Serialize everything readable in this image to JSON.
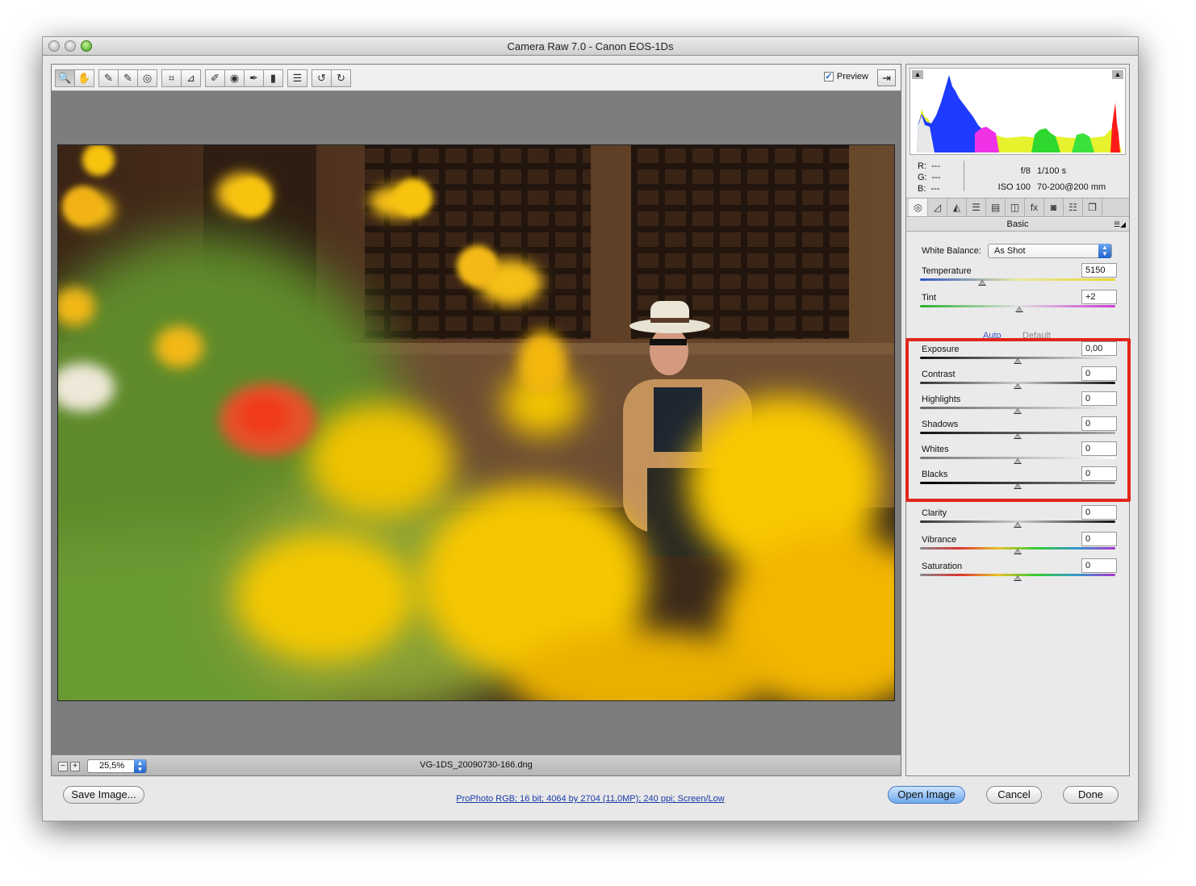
{
  "window": {
    "title": "Camera Raw 7.0  -  Canon EOS-1Ds"
  },
  "toolbar": {
    "tools": [
      {
        "name": "zoom-tool",
        "glyph": "🔍"
      },
      {
        "name": "hand-tool",
        "glyph": "✋"
      },
      {
        "name": "white-balance-tool",
        "glyph": "✎"
      },
      {
        "name": "color-sampler-tool",
        "glyph": "✎"
      },
      {
        "name": "targeted-adjustment-tool",
        "glyph": "◎"
      },
      {
        "name": "crop-tool",
        "glyph": "⌗"
      },
      {
        "name": "straighten-tool",
        "glyph": "⊿"
      },
      {
        "name": "spot-removal-tool",
        "glyph": "✐"
      },
      {
        "name": "red-eye-removal-tool",
        "glyph": "◉"
      },
      {
        "name": "adjustment-brush-tool",
        "glyph": "✒"
      },
      {
        "name": "graduated-filter-tool",
        "glyph": "▮"
      },
      {
        "name": "preferences-tool",
        "glyph": "☰"
      },
      {
        "name": "rotate-left-tool",
        "glyph": "↺"
      },
      {
        "name": "rotate-right-tool",
        "glyph": "↻"
      }
    ],
    "preview_label": "Preview",
    "preview_checked": "✓"
  },
  "status": {
    "zoom": "25,5%",
    "filename": "VG-1DS_20090730-166.dng",
    "minus": "−",
    "plus": "+"
  },
  "info": {
    "r_label": "R:",
    "r_value": "---",
    "g_label": "G:",
    "g_value": "---",
    "b_label": "B:",
    "b_value": "---",
    "aperture": "f/8",
    "shutter": "1/100 s",
    "iso": "ISO 100",
    "lens": "70-200@200 mm"
  },
  "tabs": [
    "◎",
    "◿",
    "◭",
    "☰",
    "▤",
    "◫",
    "fx",
    "◙",
    "☷",
    "❐"
  ],
  "panel": {
    "title": "Basic",
    "white_balance_label": "White Balance:",
    "white_balance_value": "As Shot",
    "auto_label": "Auto",
    "default_label": "Default",
    "sliders": {
      "temperature": {
        "label": "Temperature",
        "value": "5150",
        "level": 0.32
      },
      "tint": {
        "label": "Tint",
        "value": "+2",
        "level": 0.51
      },
      "exposure": {
        "label": "Exposure",
        "value": "0,00",
        "level": 0.5
      },
      "contrast": {
        "label": "Contrast",
        "value": "0",
        "level": 0.5
      },
      "highlights": {
        "label": "Highlights",
        "value": "0",
        "level": 0.5
      },
      "shadows": {
        "label": "Shadows",
        "value": "0",
        "level": 0.5
      },
      "whites": {
        "label": "Whites",
        "value": "0",
        "level": 0.5
      },
      "blacks": {
        "label": "Blacks",
        "value": "0",
        "level": 0.5
      },
      "clarity": {
        "label": "Clarity",
        "value": "0",
        "level": 0.5
      },
      "vibrance": {
        "label": "Vibrance",
        "value": "0",
        "level": 0.5
      },
      "saturation": {
        "label": "Saturation",
        "value": "0",
        "level": 0.5
      }
    }
  },
  "bottom": {
    "save_label": "Save Image...",
    "workflow_link": "ProPhoto RGB; 16 bit; 4064 by 2704 (11,0MP); 240 ppi; Screen/Low",
    "open_label": "Open Image",
    "cancel_label": "Cancel",
    "done_label": "Done"
  },
  "colors": {
    "highlight_frame": "#e1251b",
    "accent": "#1f62c9"
  }
}
